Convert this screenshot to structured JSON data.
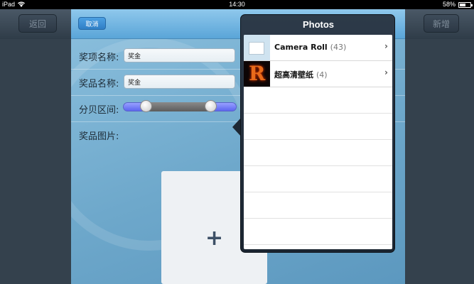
{
  "status_bar": {
    "device": "iPad",
    "time": "14:30",
    "battery": "58%",
    "battery_level": 0.58
  },
  "background_app": {
    "back_button": "返回",
    "add_button": "新增"
  },
  "form_sheet": {
    "cancel_button": "取消",
    "fields": [
      {
        "label": "奖项名称:",
        "value": "奖金"
      },
      {
        "label": "奖品名称:",
        "value": "奖金"
      }
    ],
    "range_label": "分贝区间:",
    "range_slider": {
      "low": 0.2,
      "high": 0.77
    },
    "image_label": "奖品图片:",
    "add_image": "+"
  },
  "popover": {
    "title": "Photos",
    "albums": [
      {
        "name": "Camera Roll",
        "count": "(43)",
        "thumb": "camera-roll-thumbnail"
      },
      {
        "name": "超高清壁纸",
        "count": "(4)",
        "thumb": "wallpaper-thumbnail"
      }
    ],
    "thumb_letter": "R"
  }
}
